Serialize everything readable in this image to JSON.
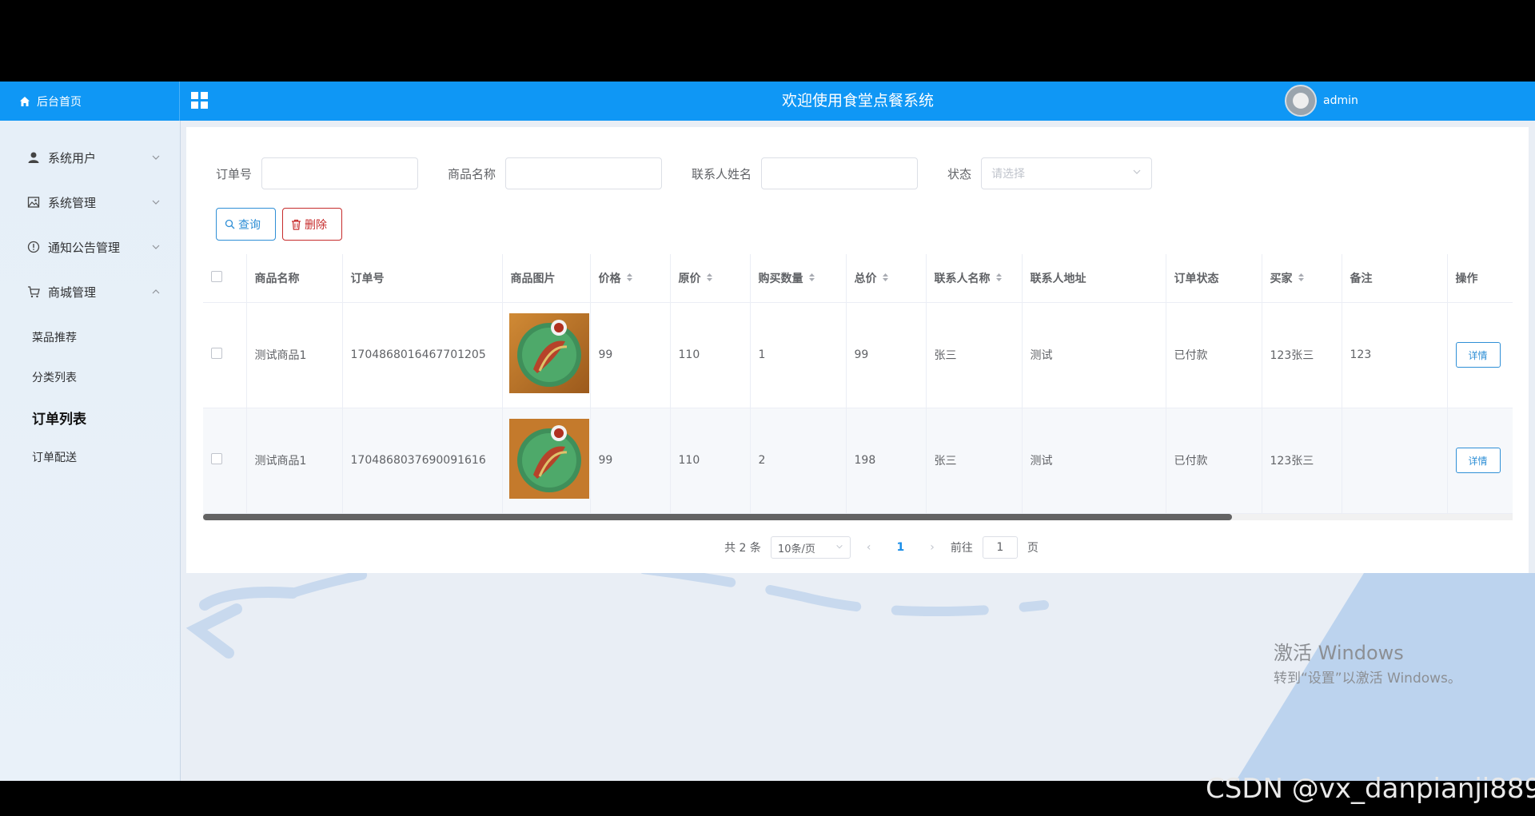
{
  "header": {
    "home_label": "后台首页",
    "title": "欢迎使用食堂点餐系统",
    "user_name": "admin"
  },
  "sidebar": {
    "items": [
      {
        "label": "系统用户",
        "icon": "user-icon"
      },
      {
        "label": "系统管理",
        "icon": "image-icon"
      },
      {
        "label": "通知公告管理",
        "icon": "info-icon"
      },
      {
        "label": "商城管理",
        "icon": "cart-icon"
      }
    ],
    "subitems": [
      "菜品推荐",
      "分类列表",
      "订单列表",
      "订单配送"
    ],
    "active_subitem": "订单列表"
  },
  "filters": {
    "order_no_label": "订单号",
    "product_name_label": "商品名称",
    "contact_name_label": "联系人姓名",
    "status_label": "状态",
    "status_placeholder": "请选择"
  },
  "buttons": {
    "search": "查询",
    "delete": "删除"
  },
  "table": {
    "headers": [
      "商品名称",
      "订单号",
      "商品图片",
      "价格",
      "原价",
      "购买数量",
      "总价",
      "联系人名称",
      "联系人地址",
      "订单状态",
      "买家",
      "备注",
      "操作"
    ],
    "rows": [
      {
        "name": "测试商品1",
        "order_no": "1704868016467701205",
        "price": "99",
        "original": "110",
        "qty": "1",
        "total": "99",
        "contact": "张三",
        "address": "测试",
        "status": "已付款",
        "buyer": "123张三",
        "remark": "123",
        "action": "详情"
      },
      {
        "name": "测试商品1",
        "order_no": "1704868037690091616",
        "price": "99",
        "original": "110",
        "qty": "2",
        "total": "198",
        "contact": "张三",
        "address": "测试",
        "status": "已付款",
        "buyer": "123张三",
        "remark": "",
        "action": "详情"
      }
    ]
  },
  "pagination": {
    "total": "共 2 条",
    "page_size": "10条/页",
    "current": "1",
    "goto_label": "前往",
    "goto_value": "1",
    "page_unit": "页"
  },
  "watermark": {
    "line1": "激活 Windows",
    "line2": "转到“设置”以激活 Windows。"
  },
  "csdn": "CSDN @vx_danpianji889",
  "colors": {
    "header_bg": "#0f97f5",
    "accent": "#2f8fd6",
    "danger": "#c62b2b"
  }
}
